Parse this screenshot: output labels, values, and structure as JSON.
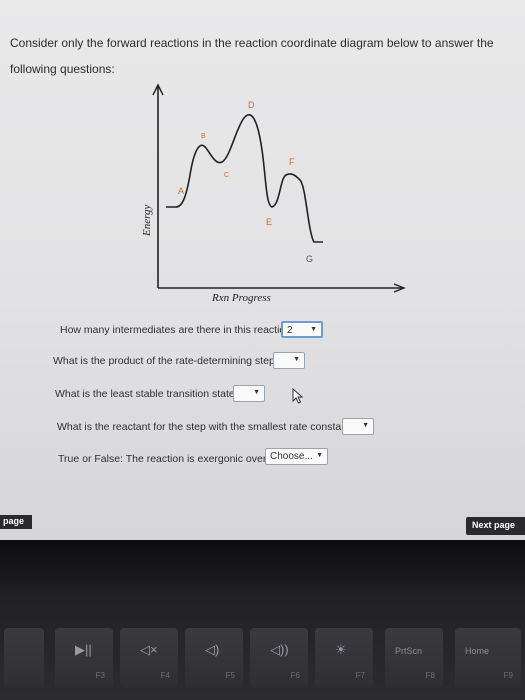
{
  "intro_text": "Consider only the forward reactions in the reaction coordinate diagram below to answer the following questions:",
  "diagram": {
    "y_axis_label": "Energy",
    "x_axis_label": "Rxn Progress",
    "points": {
      "A": "A",
      "B": "B",
      "C": "C",
      "D": "D",
      "E": "E",
      "F": "F",
      "G": "G"
    }
  },
  "questions": [
    {
      "text": "How many intermediates are there in this reaction?",
      "value": "2"
    },
    {
      "text": "What is the product of the rate-determining step?",
      "value": ""
    },
    {
      "text": "What is the least stable transition state?",
      "value": ""
    },
    {
      "text": "What is the reactant for the step with the smallest rate constant?",
      "value": ""
    },
    {
      "text": "True or False: The reaction is exergonic overall.",
      "value": "Choose..."
    }
  ],
  "nav": {
    "prev": "page",
    "next": "Next page"
  },
  "keyboard": [
    {
      "icon": "▶||",
      "fn": "F3"
    },
    {
      "icon": "◁×",
      "fn": "F4"
    },
    {
      "icon": "◁)",
      "fn": "F5"
    },
    {
      "icon": "◁))",
      "fn": "F6"
    },
    {
      "icon": "☀",
      "fn": "F7"
    },
    {
      "label": "PrtScn",
      "fn": "F8"
    },
    {
      "label": "Home",
      "fn": "F9"
    }
  ],
  "colors": {
    "accent": "#6d9bd4",
    "nav_bg": "#2a2a2c",
    "curve_text": "#d96a1a"
  }
}
